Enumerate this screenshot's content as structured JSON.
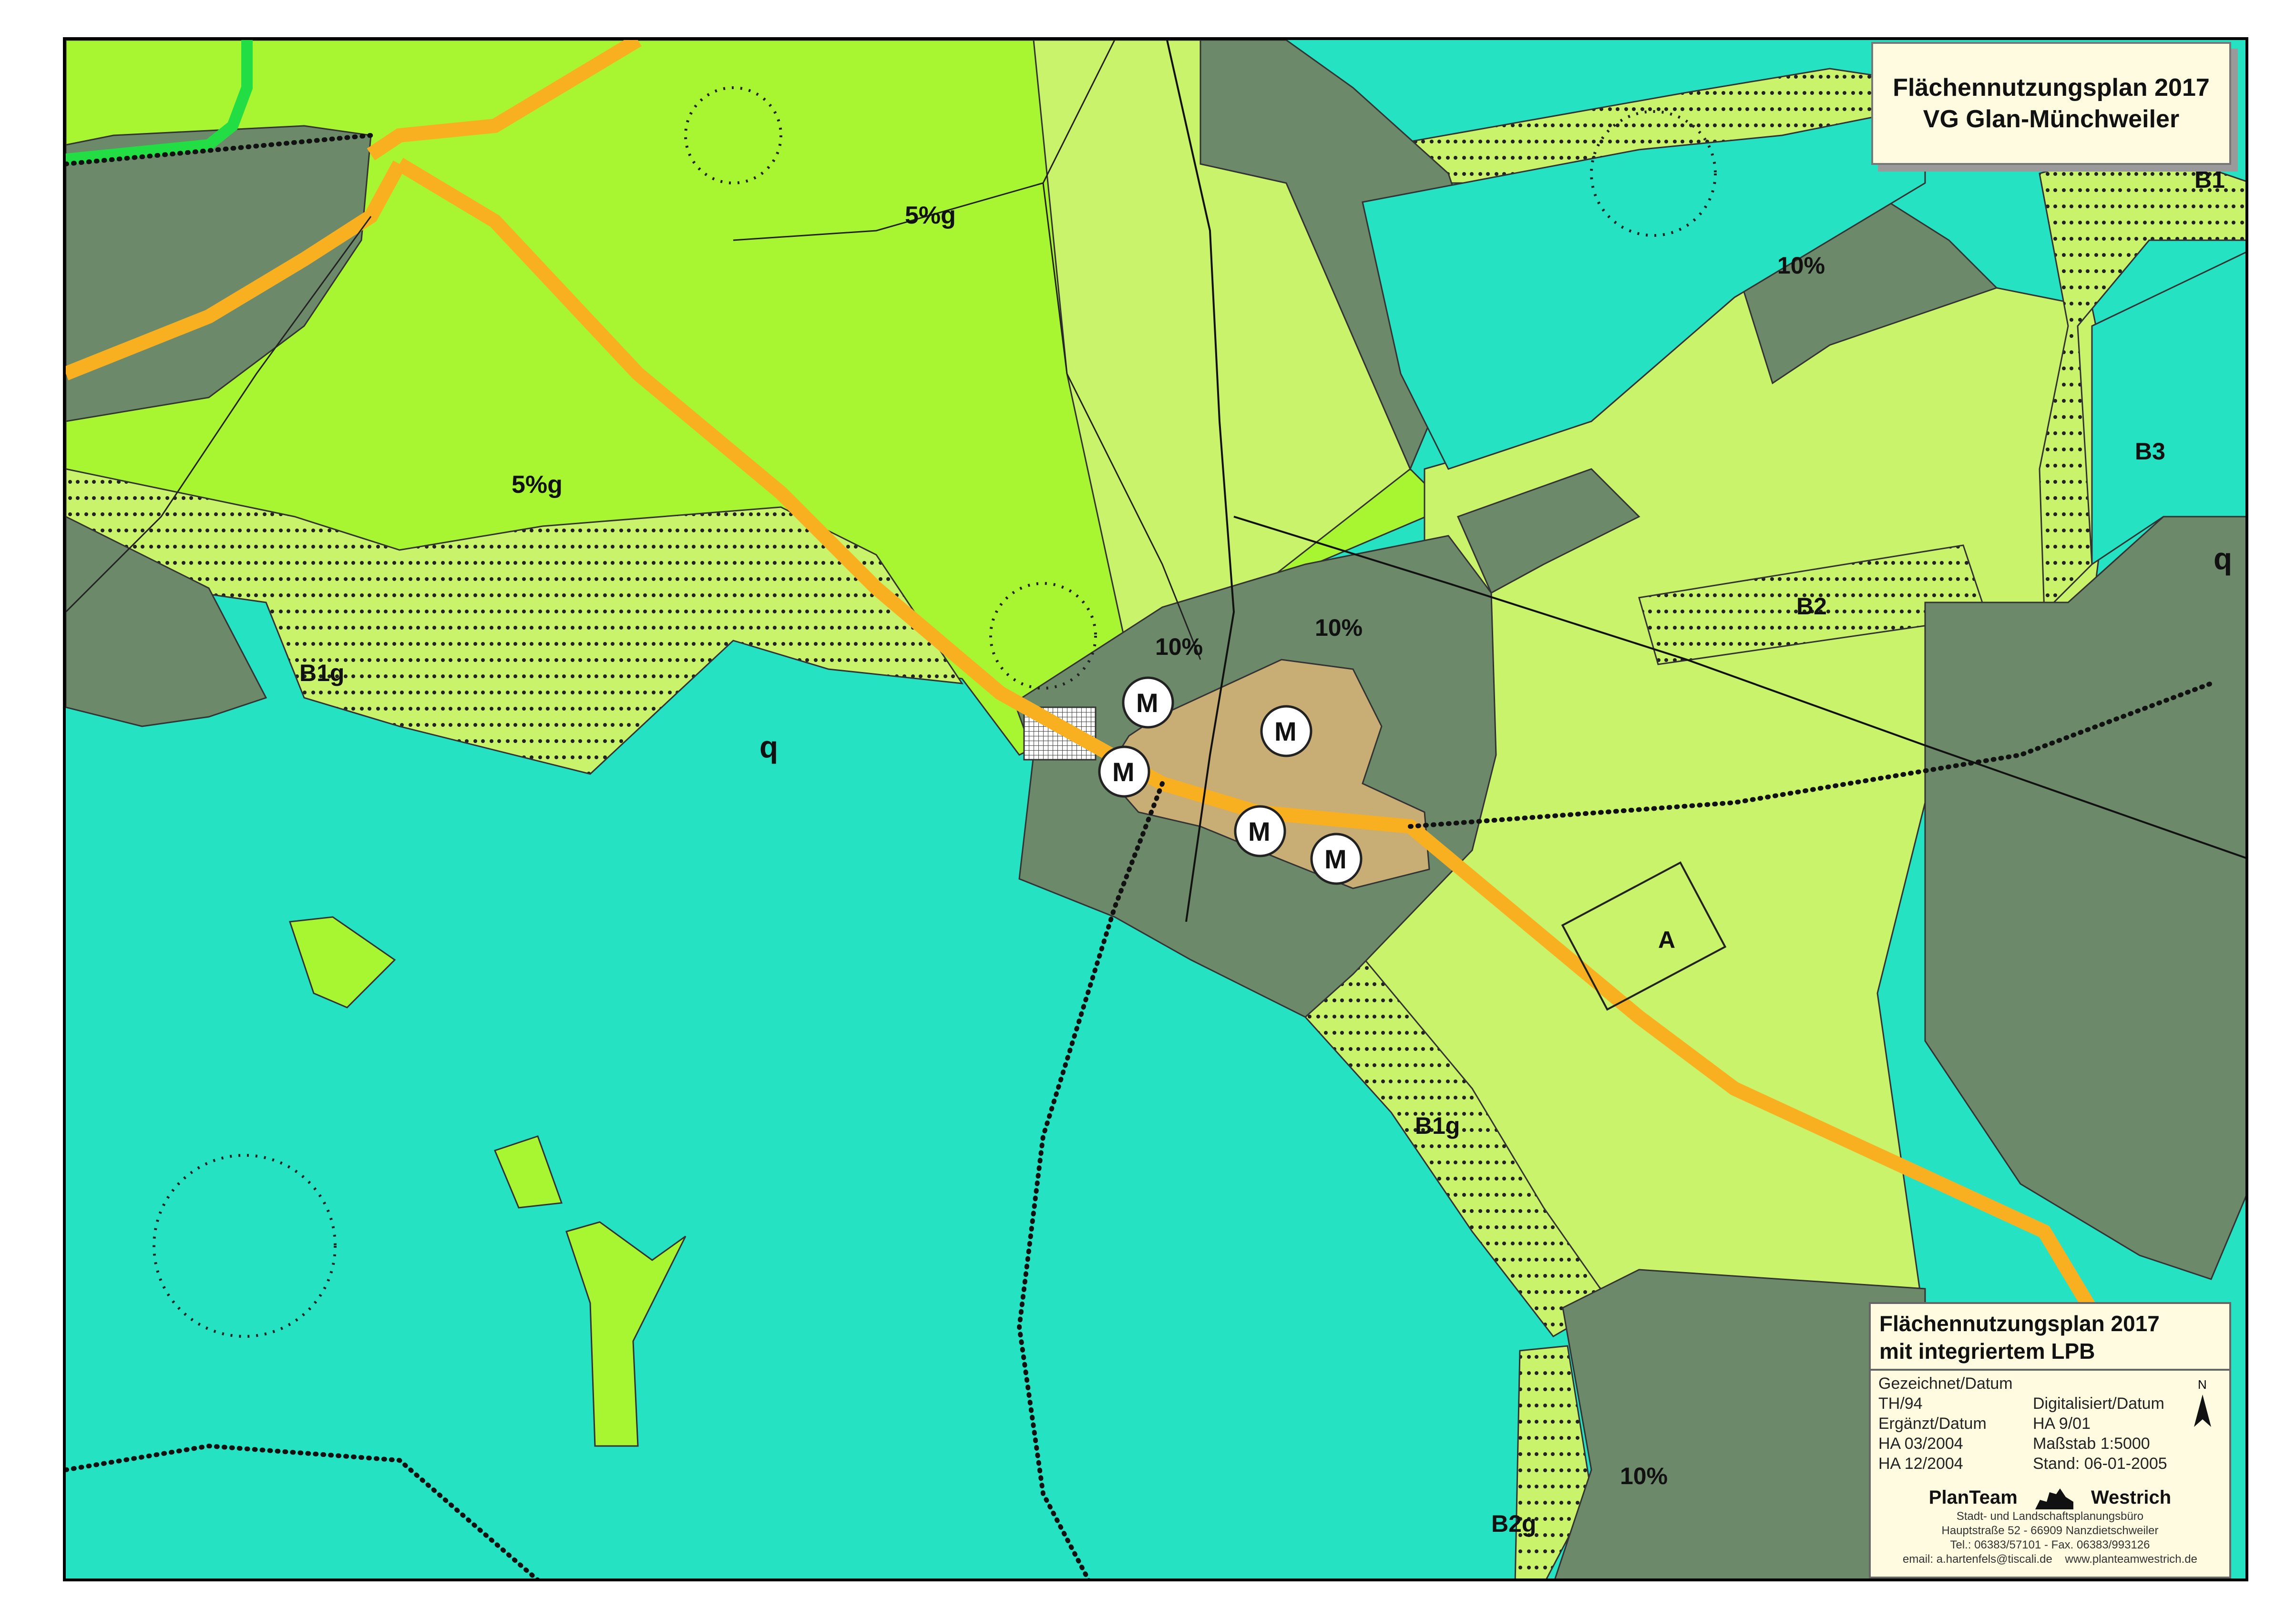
{
  "title": {
    "line1": "Flächennutzungsplan 2017",
    "line2": "VG Glan-Münchweiler"
  },
  "legend": {
    "heading1": "Flächennutzungsplan 2017",
    "heading2": "mit integriertem LPB",
    "drawn_label": "Gezeichnet/Datum",
    "drawn_value": "TH/94",
    "supplemented_label": "Ergänzt/Datum",
    "supplemented_1": "HA 03/2004",
    "supplemented_2": "HA 12/2004",
    "digitized_label": "Digitalisiert/Datum",
    "digitized_value": "HA 9/01",
    "scale": "Maßstab 1:5000",
    "status": "Stand: 06-01-2005",
    "north": "N",
    "firm_left": "PlanTeam",
    "firm_right": "Westrich",
    "firm_sub": "Stadt- und Landschaftsplanungsbüro",
    "address": "Hauptstraße 52 - 66909 Nanzdietschweiler",
    "phone": "Tel.: 06383/57101 - Fax. 06383/993126",
    "email": "email: a.hartenfels@tiscali.de",
    "web": "www.planteamwestrich.de"
  },
  "map_labels": {
    "l1": "5%g",
    "l2": "5%g",
    "l3": "10%",
    "l4": "10%",
    "l5": "10%",
    "l6": "10%",
    "l7": "B1g",
    "l8": "B1g",
    "l9": "B2",
    "l10": "B2g",
    "l11": "B3",
    "l12": "q",
    "l13": "q",
    "l14": "A",
    "l15": "B1",
    "m": "M"
  },
  "colors": {
    "meadow": "#25e3c2",
    "arable": "#a8f531",
    "grassland": "#c9f36a",
    "forest": "#6c8a6a",
    "village": "#c8ad74",
    "road": "#f8b020",
    "green_strip": "#22dd44"
  }
}
